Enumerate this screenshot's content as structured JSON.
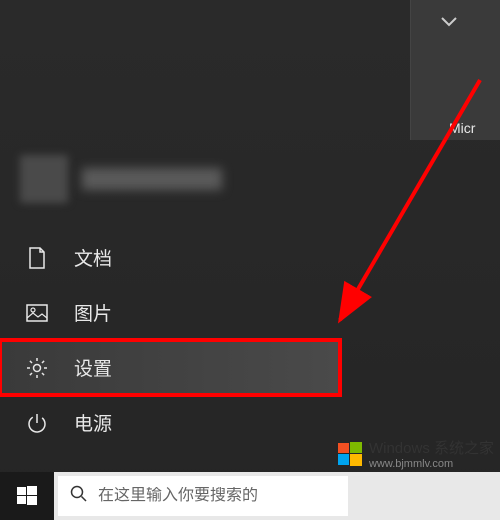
{
  "tile": {
    "label": "Micr"
  },
  "user": {
    "name_obscured": true
  },
  "menu": {
    "documents": "文档",
    "pictures": "图片",
    "settings": "设置",
    "power": "电源"
  },
  "search": {
    "placeholder": "在这里输入你要搜索的"
  },
  "watermark": {
    "title": "Windows 系统之家",
    "url": "www.bjmmlv.com"
  }
}
